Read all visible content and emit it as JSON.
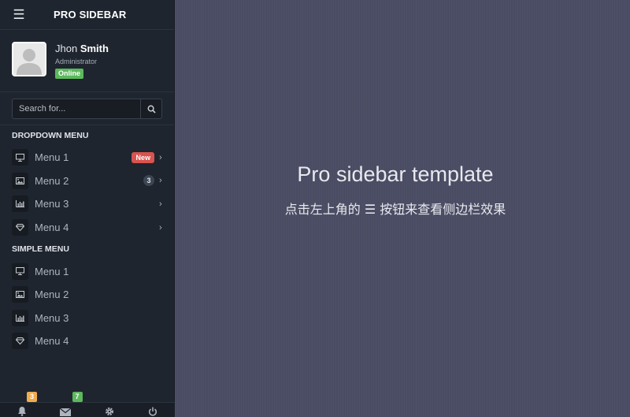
{
  "brand": {
    "title": "PRO SIDEBAR"
  },
  "profile": {
    "first_name": "Jhon",
    "last_name": "Smith",
    "role": "Administrator",
    "status": "Online"
  },
  "search": {
    "placeholder": "Search for..."
  },
  "dropdown_menu": {
    "header": "DROPDOWN MENU",
    "items": [
      {
        "label": "Menu 1",
        "icon": "monitor-icon",
        "badge": "New"
      },
      {
        "label": "Menu 2",
        "icon": "image-icon",
        "badge": "3"
      },
      {
        "label": "Menu 3",
        "icon": "chart-icon",
        "badge": ""
      },
      {
        "label": "Menu 4",
        "icon": "diamond-icon",
        "badge": ""
      }
    ]
  },
  "simple_menu": {
    "header": "SIMPLE MENU",
    "items": [
      {
        "label": "Menu 1",
        "icon": "monitor-icon"
      },
      {
        "label": "Menu 2",
        "icon": "image-icon"
      },
      {
        "label": "Menu 3",
        "icon": "chart-icon"
      },
      {
        "label": "Menu 4",
        "icon": "diamond-icon"
      }
    ]
  },
  "footer": {
    "notifications_count": "3",
    "messages_count": "7"
  },
  "main": {
    "title": "Pro sidebar template",
    "subtitle": "点击左上角的 ☰ 按钮来查看侧边栏效果"
  },
  "colors": {
    "sidebar_bg": "#1f252f",
    "main_bg": "#4a4c63",
    "online": "#5cb85c",
    "new_badge": "#d9534f",
    "notif_badge": "#f0ad4e",
    "msg_badge": "#5cb85c"
  }
}
